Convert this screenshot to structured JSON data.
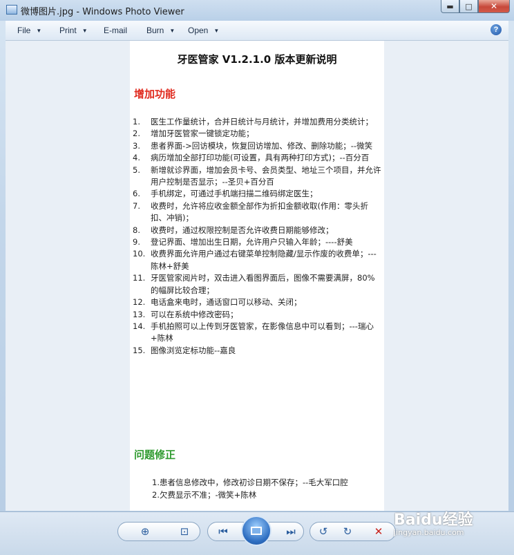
{
  "window": {
    "title": "微博图片.jpg - Windows Photo Viewer",
    "minimize_symbol": "▬",
    "maximize_symbol": "□",
    "close_symbol": "✕"
  },
  "menu": {
    "file": "File",
    "print": "Print",
    "email": "E-mail",
    "burn": "Burn",
    "open": "Open",
    "help_symbol": "?"
  },
  "document": {
    "title": "牙医管家 V1.2.1.0 版本更新说明",
    "section1_heading": "增加功能",
    "section1_color": "#e02a1e",
    "features": [
      {
        "num": "1.",
        "text": "医生工作量统计，合并日统计与月统计，并增加费用分类统计；"
      },
      {
        "num": "2.",
        "text": "增加牙医管家一键锁定功能；"
      },
      {
        "num": "3.",
        "text": "患者界面->回访模块，恢复回访增加、修改、删除功能；--微笑"
      },
      {
        "num": "4.",
        "text": "病历增加全部打印功能(可设置，具有两种打印方式)；--百分百"
      },
      {
        "num": "5.",
        "text": "新增就诊界面，增加会员卡号、会员类型、地址三个项目，并允许用户控制是否显示；--圣贝+百分百"
      },
      {
        "num": "6.",
        "text": "手机绑定，可通过手机端扫描二维码绑定医生；"
      },
      {
        "num": "7.",
        "text": "收费时，允许将应收金额全部作为折扣金额收取(作用：零头折扣、冲销)；"
      },
      {
        "num": "8.",
        "text": "收费时，通过权限控制是否允许收费日期能够修改；"
      },
      {
        "num": "9.",
        "text": "登记界面、增加出生日期，允许用户只输入年龄；----舒美"
      },
      {
        "num": "10.",
        "text": "收费界面允许用户通过右键菜单控制隐藏/显示作废的收费单；---陈林+舒美"
      },
      {
        "num": "11.",
        "text": "牙医管家阅片时，双击进入看图界面后，图像不需要满屏，80%的幅屏比较合理；"
      },
      {
        "num": "12.",
        "text": "电话盒来电时，通话窗口可以移动、关闭；"
      },
      {
        "num": "13.",
        "text": "可以在系统中修改密码；"
      },
      {
        "num": "14.",
        "text": "手机拍照可以上传到牙医管家，在影像信息中可以看到；---瑞心+陈林"
      },
      {
        "num": "15.",
        "text": "图像浏览定标功能--嘉良"
      }
    ],
    "section2_heading": "问题修正",
    "section2_color": "#2e9a2e",
    "fixes": [
      "1.患者信息修改中，修改初诊日期不保存；--毛大军口腔",
      "2.欠费显示不准；-微笑+陈林"
    ]
  },
  "toolbar": {
    "zoom_icon": "⊕",
    "actual_size_icon": "⊡",
    "previous_icon": "⏮",
    "next_icon": "⏭",
    "rotate_ccw_icon": "↺",
    "rotate_cw_icon": "↻",
    "delete_icon": "✕"
  },
  "watermark": {
    "logo": "Baidu经验",
    "url": "jingyan.baidu.com"
  }
}
